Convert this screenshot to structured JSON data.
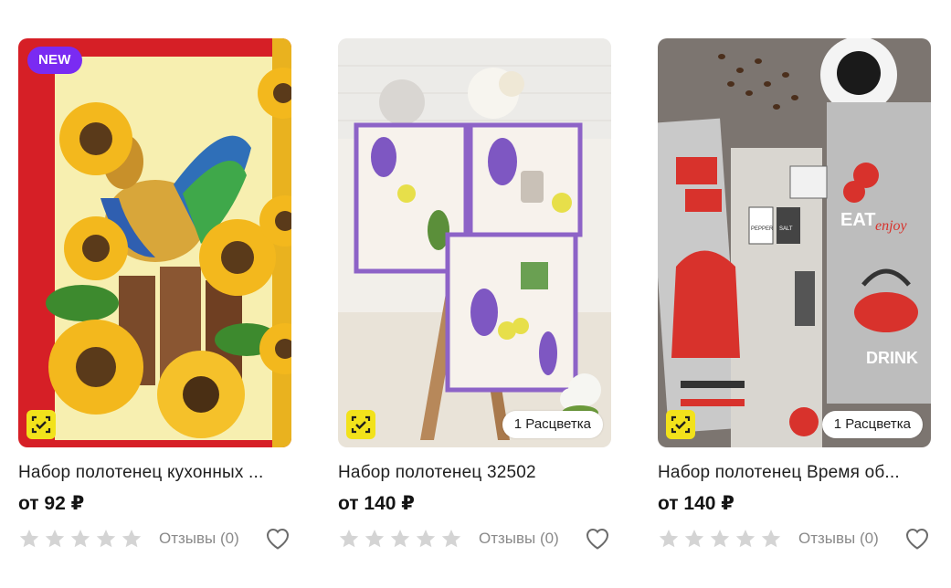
{
  "products": [
    {
      "badge": "NEW",
      "title": "Набор полотенец кухонных ...",
      "price": "от 92 ₽",
      "reviews": "Отзывы (0)",
      "rating": 0,
      "colors": ""
    },
    {
      "badge": "",
      "title": "Набор полотенец 32502",
      "price": "от 140 ₽",
      "reviews": "Отзывы (0)",
      "rating": 0,
      "colors": "1 Расцветка"
    },
    {
      "badge": "",
      "title": "Набор полотенец Время об...",
      "price": "от 140 ₽",
      "reviews": "Отзывы (0)",
      "rating": 0,
      "colors": "1 Расцветка"
    }
  ],
  "art_text": {
    "eat": "EAT",
    "enjoy": "enjoy",
    "drink": "DRINK",
    "pepper": "PEPPER",
    "salt": "SALT"
  },
  "icons": {
    "verified": "checked-badge-icon",
    "star": "star-icon",
    "favorite": "heart-icon"
  },
  "colors": {
    "new_badge": "#7a2bf2",
    "check_badge": "#f2e21b",
    "star_empty": "#d4d4d4",
    "text_muted": "#8a8a8a"
  }
}
